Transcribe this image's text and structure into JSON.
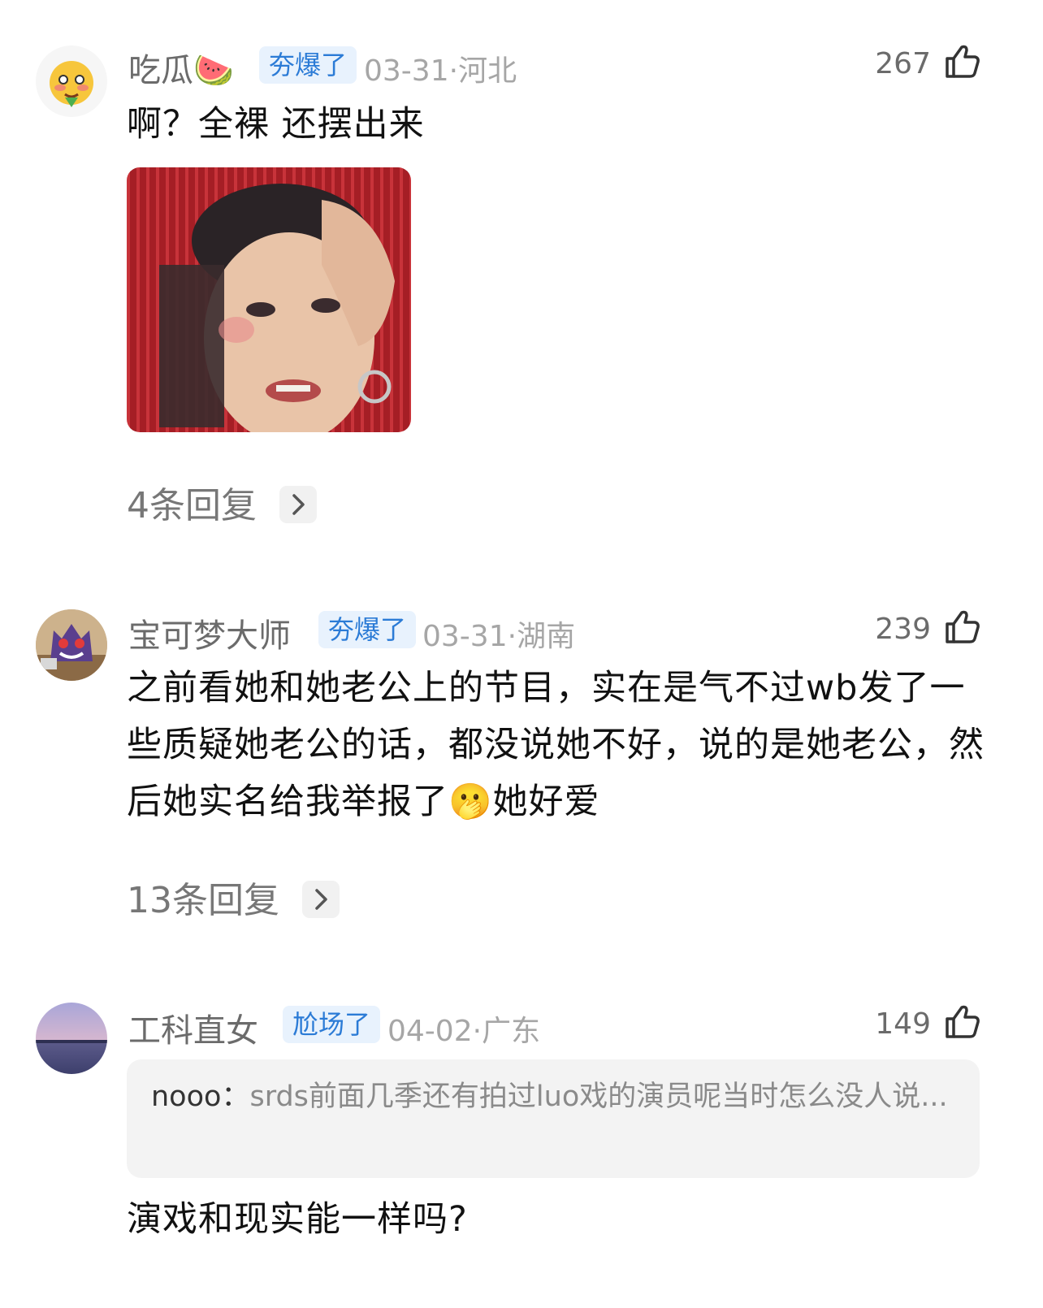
{
  "comments": [
    {
      "username": "吃瓜🍉",
      "tag": "夯爆了",
      "date": "03-31",
      "location": "河北",
      "likes": "267",
      "text": "啊？全裸 还摆出来",
      "replies": "4条回复",
      "avatar": "blushing-face-avatar"
    },
    {
      "username": "宝可梦大师",
      "tag": "夯爆了",
      "date": "03-31",
      "location": "湖南",
      "likes": "239",
      "text": "之前看她和她老公上的节目，实在是气不过wb发了一些质疑她老公的话，都没说她不好，说的是她老公，然后她实名给我举报了🫢她好爱",
      "replies": "13条回复",
      "avatar": "gengar-avatar"
    },
    {
      "username": "工科直女",
      "tag": "尬场了",
      "date": "04-02",
      "location": "广东",
      "likes": "149",
      "quote_user": "nooo",
      "quote_text": "srds前面几季还有拍过luo戏的演员呢当时怎么没人说...",
      "text": "演戏和现实能一样吗?",
      "avatar": "sunset-sea-avatar"
    }
  ],
  "separator": "·",
  "colors": {
    "tag_bg": "#e8f2fd",
    "tag_text": "#2b7bd6",
    "meta": "#a6a6a6",
    "quote_bg": "#f3f3f3"
  }
}
